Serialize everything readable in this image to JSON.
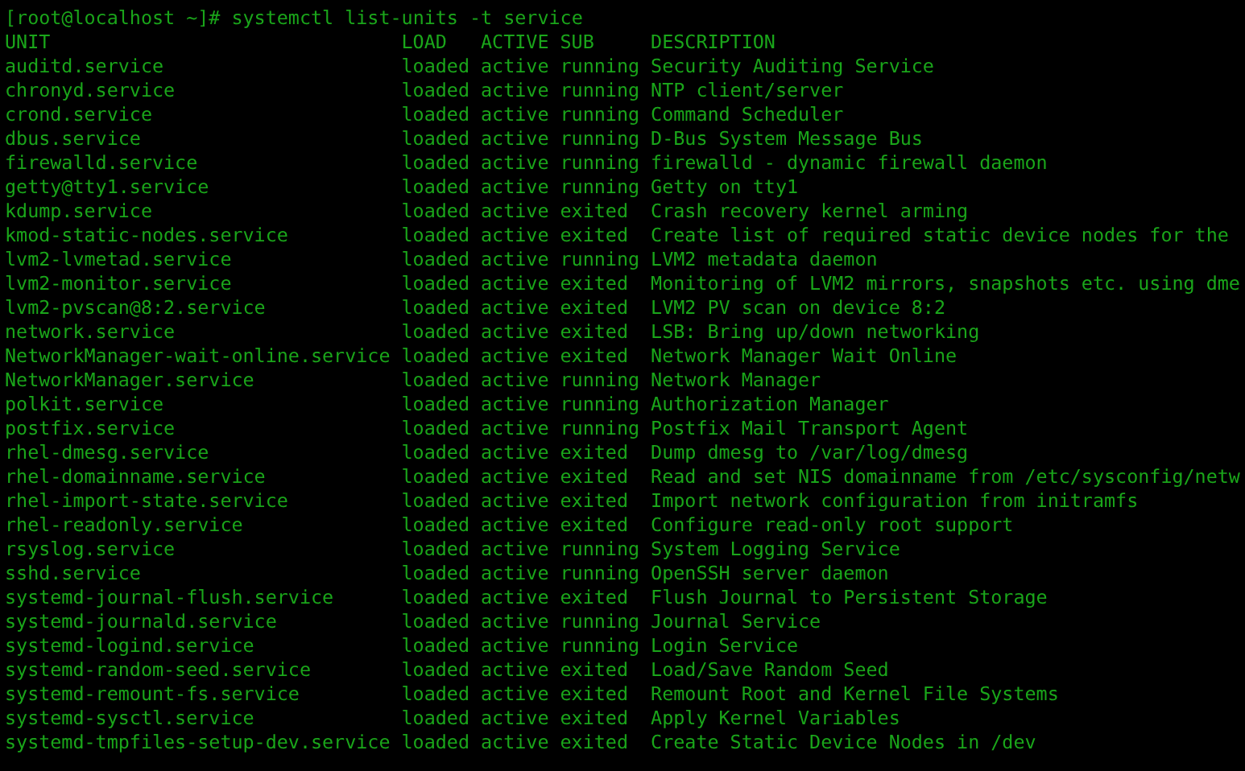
{
  "prompt": {
    "text": "[root@localhost ~]# systemctl list-units -t service"
  },
  "table": {
    "columns": [
      "UNIT",
      "LOAD",
      "ACTIVE",
      "SUB",
      "DESCRIPTION"
    ],
    "rows": [
      [
        "auditd.service",
        "loaded",
        "active",
        "running",
        "Security Auditing Service"
      ],
      [
        "chronyd.service",
        "loaded",
        "active",
        "running",
        "NTP client/server"
      ],
      [
        "crond.service",
        "loaded",
        "active",
        "running",
        "Command Scheduler"
      ],
      [
        "dbus.service",
        "loaded",
        "active",
        "running",
        "D-Bus System Message Bus"
      ],
      [
        "firewalld.service",
        "loaded",
        "active",
        "running",
        "firewalld - dynamic firewall daemon"
      ],
      [
        "getty@tty1.service",
        "loaded",
        "active",
        "running",
        "Getty on tty1"
      ],
      [
        "kdump.service",
        "loaded",
        "active",
        "exited",
        "Crash recovery kernel arming"
      ],
      [
        "kmod-static-nodes.service",
        "loaded",
        "active",
        "exited",
        "Create list of required static device nodes for the"
      ],
      [
        "lvm2-lvmetad.service",
        "loaded",
        "active",
        "running",
        "LVM2 metadata daemon"
      ],
      [
        "lvm2-monitor.service",
        "loaded",
        "active",
        "exited",
        "Monitoring of LVM2 mirrors, snapshots etc. using dme"
      ],
      [
        "lvm2-pvscan@8:2.service",
        "loaded",
        "active",
        "exited",
        "LVM2 PV scan on device 8:2"
      ],
      [
        "network.service",
        "loaded",
        "active",
        "exited",
        "LSB: Bring up/down networking"
      ],
      [
        "NetworkManager-wait-online.service",
        "loaded",
        "active",
        "exited",
        "Network Manager Wait Online"
      ],
      [
        "NetworkManager.service",
        "loaded",
        "active",
        "running",
        "Network Manager"
      ],
      [
        "polkit.service",
        "loaded",
        "active",
        "running",
        "Authorization Manager"
      ],
      [
        "postfix.service",
        "loaded",
        "active",
        "running",
        "Postfix Mail Transport Agent"
      ],
      [
        "rhel-dmesg.service",
        "loaded",
        "active",
        "exited",
        "Dump dmesg to /var/log/dmesg"
      ],
      [
        "rhel-domainname.service",
        "loaded",
        "active",
        "exited",
        "Read and set NIS domainname from /etc/sysconfig/netw"
      ],
      [
        "rhel-import-state.service",
        "loaded",
        "active",
        "exited",
        "Import network configuration from initramfs"
      ],
      [
        "rhel-readonly.service",
        "loaded",
        "active",
        "exited",
        "Configure read-only root support"
      ],
      [
        "rsyslog.service",
        "loaded",
        "active",
        "running",
        "System Logging Service"
      ],
      [
        "sshd.service",
        "loaded",
        "active",
        "running",
        "OpenSSH server daemon"
      ],
      [
        "systemd-journal-flush.service",
        "loaded",
        "active",
        "exited",
        "Flush Journal to Persistent Storage"
      ],
      [
        "systemd-journald.service",
        "loaded",
        "active",
        "running",
        "Journal Service"
      ],
      [
        "systemd-logind.service",
        "loaded",
        "active",
        "running",
        "Login Service"
      ],
      [
        "systemd-random-seed.service",
        "loaded",
        "active",
        "exited",
        "Load/Save Random Seed"
      ],
      [
        "systemd-remount-fs.service",
        "loaded",
        "active",
        "exited",
        "Remount Root and Kernel File Systems"
      ],
      [
        "systemd-sysctl.service",
        "loaded",
        "active",
        "exited",
        "Apply Kernel Variables"
      ],
      [
        "systemd-tmpfiles-setup-dev.service",
        "loaded",
        "active",
        "exited",
        "Create Static Device Nodes in /dev"
      ]
    ]
  }
}
